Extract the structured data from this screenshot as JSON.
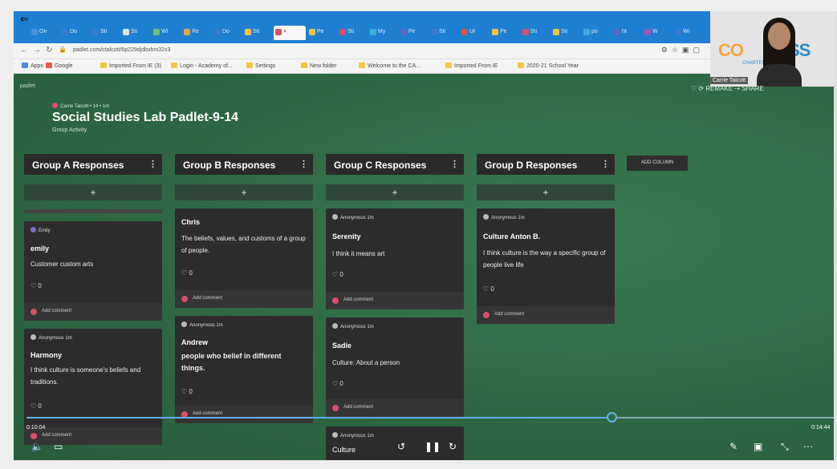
{
  "browser": {
    "tabs": [
      {
        "label": "On",
        "color": "#4a90d9"
      },
      {
        "label": "Do",
        "color": "#3b7bd4"
      },
      {
        "label": "Sti",
        "color": "#3b7bd4"
      },
      {
        "label": "Sti",
        "color": "#e3e3e3"
      },
      {
        "label": "WI",
        "color": "#6fc26f"
      },
      {
        "label": "Re",
        "color": "#e0a93a"
      },
      {
        "label": "Do",
        "color": "#3b7bd4"
      },
      {
        "label": "Sti",
        "color": "#f4c542"
      },
      {
        "label": "",
        "color": "#d9506b",
        "active": true
      },
      {
        "label": "Pe",
        "color": "#f4c542"
      },
      {
        "label": "Sti",
        "color": "#d9506b"
      },
      {
        "label": "My",
        "color": "#3bb0d4"
      },
      {
        "label": "Pe",
        "color": "#5c6bc0"
      },
      {
        "label": "Sti",
        "color": "#3b7bd4"
      },
      {
        "label": "Ur",
        "color": "#d9534f"
      },
      {
        "label": "Pe",
        "color": "#f4c542"
      },
      {
        "label": "Sti",
        "color": "#d9506b"
      },
      {
        "label": "Sti",
        "color": "#f4c542"
      },
      {
        "label": "po",
        "color": "#3bb0d4"
      },
      {
        "label": "ht",
        "color": "#5c6bc0"
      },
      {
        "label": "W",
        "color": "#9b59b6"
      },
      {
        "label": "Wi",
        "color": "#3b7bd4"
      }
    ],
    "url": "padlet.com/ctalcott/6p229djdbxhm32x3",
    "bookmarks": [
      "Apps",
      "Google",
      "Imported From IE (3)",
      "Login - Academy of...",
      "Settings",
      "New folder",
      "Welcome to the CA...",
      "Imported From IE",
      "2020-21 School Year"
    ]
  },
  "webcam": {
    "logo_left": "CO",
    "logo_right": "SS",
    "logo_sub": "CHARTER SCHOOLS",
    "name": "Carrie Talcott"
  },
  "padlet": {
    "brand": "padlet",
    "top_right": "♡  ⟳ REMAKE   ⇢ SHARE",
    "author": "Carrie Talcott  •  14  •  1m",
    "title": "Social Studies Lab Padlet-9-14",
    "subtitle": "Group Activity",
    "add_column": "ADD COLUMN",
    "add_symbol": "+",
    "kebab": "⋮",
    "like_symbol": "♡ 0",
    "add_comment": "Add comment",
    "columns": [
      {
        "title": "Group A Responses"
      },
      {
        "title": "Group B Responses"
      },
      {
        "title": "Group C Responses"
      },
      {
        "title": "Group D Responses"
      }
    ],
    "cards": {
      "a1": {
        "meta": "Emily",
        "title": "emily",
        "body": "Customer custom arts"
      },
      "a2": {
        "meta": "Anonymous  1m",
        "title": "Harmony",
        "body": "I think culture is someone's beliefs and traditions."
      },
      "b1": {
        "title": "Chris",
        "body": "The beliefs, values, and customs of a group of people."
      },
      "b2": {
        "meta": "Anonymous  1m",
        "title": "Andrew",
        "body": "people who belief in different things."
      },
      "c1": {
        "meta": "Anonymous  1m",
        "title": "Serenity",
        "body": "I think it means art"
      },
      "c2": {
        "meta": "Anonymous  1m",
        "title": "Sadie",
        "body": "Culture:  About a person"
      },
      "c3": {
        "meta": "Anonymous  1m",
        "title": "Culture"
      },
      "d1": {
        "meta": "Anonymous  1m",
        "title": "Culture Anton B.",
        "body": "I think culture is the way a specific group of people live life"
      }
    }
  },
  "player": {
    "current_time": "0:10:04",
    "duration": "0:14:44",
    "progress": 0.725
  }
}
